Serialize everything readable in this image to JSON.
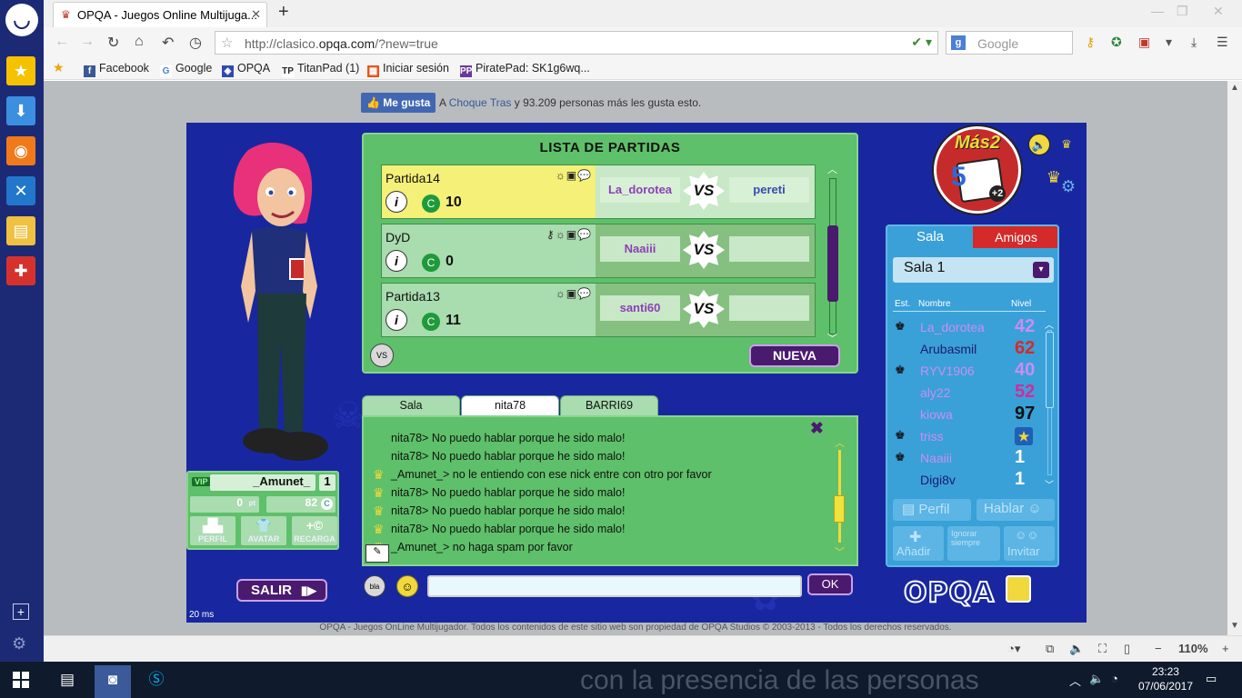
{
  "browser": {
    "tab_title": "OPQA - Juegos Online Multijuga...",
    "url_prefix": "http://clasico.",
    "url_domain": "opqa.com",
    "url_suffix": "/?new=true",
    "search_placeholder": "Google",
    "bookmarks": [
      "Facebook",
      "Google",
      "OPQA",
      "TitanPad (1)",
      "Iniciar sesión",
      "PiratePad: SK1g6wq..."
    ],
    "zoom": "110%"
  },
  "page": {
    "like_button": "Me gusta",
    "like_prefix": "A",
    "like_user": "Choque Tras",
    "like_suffix": "y 93.209 personas más les gusta esto.",
    "footer": "OPQA - Juegos OnLine Multijugador. Todos los contenidos de este sitio web son propiedad de OPQA Studios © 2003-2013 - Todos los derechos reservados."
  },
  "game": {
    "latency": "20 ms",
    "profile": {
      "vip": "VIP",
      "nick": "_Amunet_",
      "level": "1",
      "points": "0",
      "points_unit": "pt",
      "coins": "82",
      "btn_perfil": "PERFIL",
      "btn_avatar": "AVATAR",
      "btn_recarga": "RECARGA"
    },
    "salir": "SALIR",
    "lista": {
      "title": "LISTA DE PARTIDAS",
      "matches": [
        {
          "name": "Partida14",
          "bet": "10",
          "p1": "La_dorotea",
          "p2": "pereti"
        },
        {
          "name": "DyD",
          "bet": "0",
          "p1": "Naaiii",
          "p2": ""
        },
        {
          "name": "Partida13",
          "bet": "11",
          "p1": "santi60",
          "p2": ""
        }
      ],
      "vs": "VS",
      "info": "i",
      "nueva": "NUEVA"
    },
    "chat": {
      "tabs": [
        "Sala",
        "nita78",
        "BARRI69"
      ],
      "messages": [
        {
          "text": "nita78> No puedo hablar porque he sido malo!",
          "crown": false
        },
        {
          "text": "nita78> No puedo hablar porque he sido malo!",
          "crown": false
        },
        {
          "text": "_Amunet_> no le entiendo con ese nick entre con otro por favor",
          "crown": true
        },
        {
          "text": "nita78> No puedo hablar porque he sido malo!",
          "crown": true
        },
        {
          "text": "nita78> No puedo hablar porque he sido malo!",
          "crown": true
        },
        {
          "text": "nita78> No puedo hablar porque he sido malo!",
          "crown": true
        },
        {
          "text": "_Amunet_> no haga spam por favor",
          "crown": true
        }
      ],
      "ok": "OK"
    },
    "mas2": "Más2",
    "sala": {
      "tab_sala": "Sala",
      "tab_amigos": "Amigos",
      "room": "Sala 1",
      "col_est": "Est.",
      "col_nombre": "Nombre",
      "col_nivel": "Nivel",
      "players": [
        {
          "name": "La_dorotea",
          "level": "42",
          "level_color": "#c98ef2",
          "status": true
        },
        {
          "name": "Arubasmil",
          "level": "62",
          "level_color": "#d42a2a",
          "status": false
        },
        {
          "name": "RYV1906",
          "level": "40",
          "level_color": "#c98ef2",
          "status": true
        },
        {
          "name": "aly22",
          "level": "52",
          "level_color": "#d42a9a",
          "status": false
        },
        {
          "name": "kiowa",
          "level": "97",
          "level_color": "#111111",
          "status": false
        },
        {
          "name": "triss",
          "level": "",
          "level_color": "#111111",
          "status": true
        },
        {
          "name": "Naaiii",
          "level": "1",
          "level_color": "#ffffff",
          "status": true
        },
        {
          "name": "Digi8v",
          "level": "1",
          "level_color": "#ffffff",
          "status": false
        }
      ],
      "name_colors": [
        "#c98ef2",
        "#1b1b6e",
        "#c98ef2",
        "#c98ef2",
        "#c98ef2",
        "#c98ef2",
        "#c98ef2",
        "#1b1b6e"
      ],
      "btn_perfil": "Perfil",
      "btn_hablar": "Hablar",
      "btn_anadir": "Añadir",
      "btn_ignorar": "Ignorar siempre",
      "btn_invitar": "Invitar"
    },
    "logo": "OPQA"
  },
  "taskbar": {
    "time": "23:23",
    "date": "07/06/2017",
    "watermark": "con la presencia de las personas"
  },
  "colors": {
    "game_bg": "#1827a0",
    "panel_green": "#5ec06a",
    "accent_purple": "#4a1a6e",
    "sala_blue": "#3aa0d8",
    "amigos_red": "#d42a2a"
  }
}
